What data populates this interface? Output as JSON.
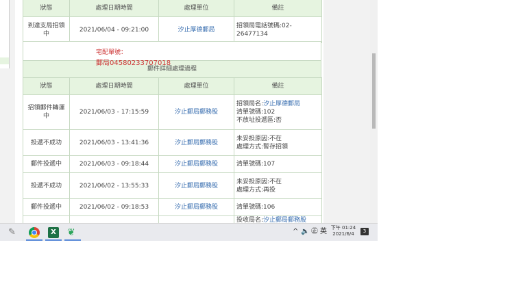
{
  "table1": {
    "headers": [
      "狀態",
      "處理日期時間",
      "處理單位",
      "備註"
    ],
    "row": {
      "status": "到達支局招領中",
      "datetime": "2021/06/04 - 09:21:00",
      "unit": "汐止厚德郵局",
      "note": "招領局電話號碼:02-26477134"
    }
  },
  "split": {
    "line1": "宅配單號：",
    "line2": "郵局04580233707018",
    "section_title": "郵件詳細處理過程"
  },
  "table2": {
    "headers": [
      "狀態",
      "處理日期時間",
      "處理單位",
      "備註"
    ],
    "rows": [
      {
        "status": "招領郵件轉運中",
        "datetime": "2021/06/03 - 17:15:59",
        "unit": "汐止郵局郵務股",
        "note_prefix": "招領局名:",
        "note_link": "汐止厚德郵局",
        "note_lines": [
          "清單號碼:102",
          "不放址投遞區:否"
        ]
      },
      {
        "status": "投遞不成功",
        "datetime": "2021/06/03 - 13:41:36",
        "unit": "汐止郵局郵務股",
        "note_lines": [
          "未妥投原因:不在",
          "處理方式:暫存招領"
        ]
      },
      {
        "status": "郵件投遞中",
        "datetime": "2021/06/03 - 09:18:44",
        "unit": "汐止郵局郵務股",
        "note_lines": [
          "清單號碼:107"
        ]
      },
      {
        "status": "投遞不成功",
        "datetime": "2021/06/02 - 13:55:33",
        "unit": "汐止郵局郵務股",
        "note_lines": [
          "未妥投原因:不在",
          "處理方式:再投"
        ]
      },
      {
        "status": "郵件投遞中",
        "datetime": "2021/06/02 - 09:18:53",
        "unit": "汐止郵局郵務股",
        "note_lines": [
          "清單號碼:106"
        ]
      },
      {
        "status": "",
        "datetime": "",
        "unit": "",
        "note_prefix": "投收局名:",
        "note_link": "汐止郵局郵務股",
        "note_lines": []
      }
    ]
  },
  "taskbar": {
    "icons": [
      "pen-icon",
      "chrome-icon",
      "excel-icon",
      "line-app-icon"
    ],
    "excel_label": "X",
    "tray_chevron": "^",
    "tray_volume": "🔈",
    "tray_ime": "㊣",
    "tray_lang": "英",
    "time": "下午 01:24",
    "date": "2021/6/4",
    "notification_count": "3"
  },
  "colors": {
    "header_bg": "#e6f4e0",
    "link": "#3a6fb0",
    "red_text": "#cc3333",
    "border": "#c6d9c1"
  }
}
